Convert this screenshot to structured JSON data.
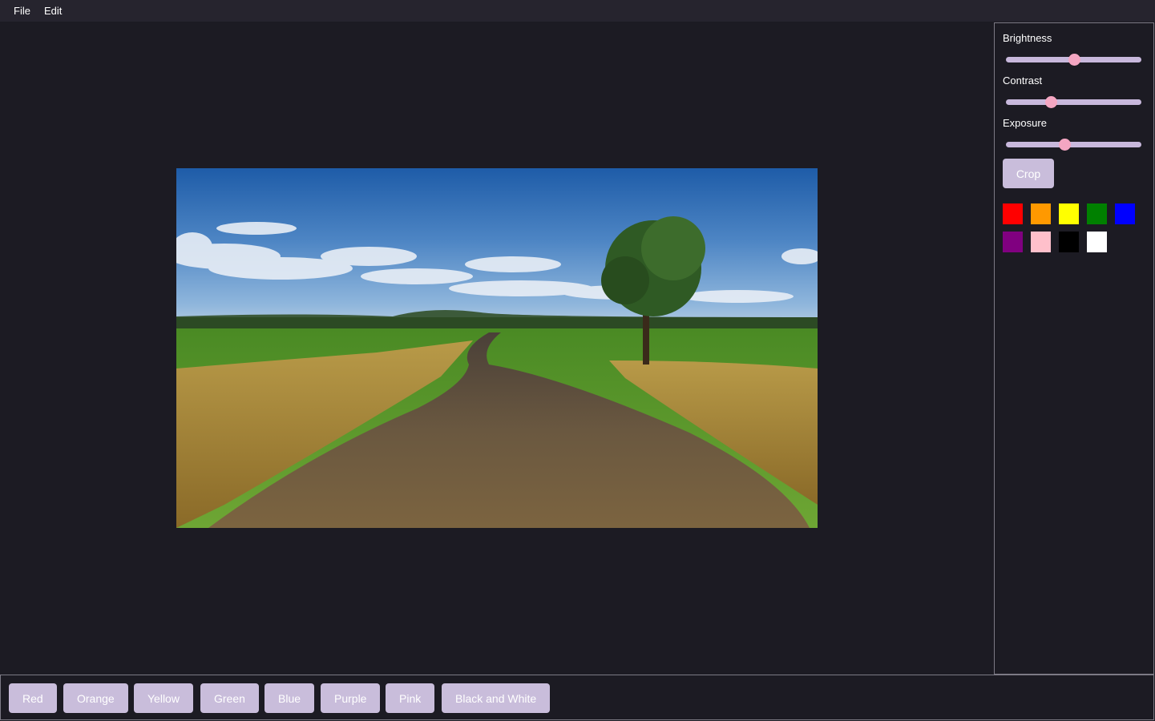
{
  "menu": {
    "items": [
      "File",
      "Edit"
    ]
  },
  "panel": {
    "sliders": [
      {
        "label": "Brightness",
        "value": 0.5
      },
      {
        "label": "Contrast",
        "value": 0.33
      },
      {
        "label": "Exposure",
        "value": 0.43
      }
    ],
    "crop_label": "Crop",
    "swatches": [
      "#ff0000",
      "#ff9900",
      "#ffff00",
      "#008000",
      "#0000ff",
      "#800080",
      "#ffc0cb",
      "#000000",
      "#ffffff"
    ]
  },
  "filters": [
    "Red",
    "Orange",
    "Yellow",
    "Green",
    "Blue",
    "Purple",
    "Pink",
    "Black and White"
  ],
  "colors": {
    "accent": "#c9bddb",
    "thumb": "#f4a6c2",
    "background": "#1c1b23",
    "menubar": "#26242e"
  }
}
